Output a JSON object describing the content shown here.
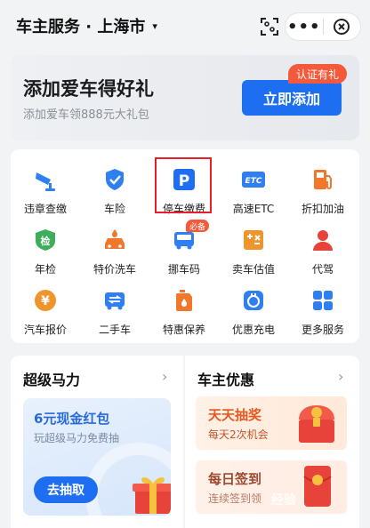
{
  "header": {
    "title": "车主服务 · 上海市",
    "caret": "▾",
    "more_label": "•••",
    "scan_icon": "scan-icon",
    "close_icon": "close-icon"
  },
  "banner": {
    "title": "添加爱车得好礼",
    "subtitle": "添加爱车领888元大礼包",
    "button_label": "立即添加",
    "badge": "认证有礼"
  },
  "services": {
    "items": [
      {
        "label": "违章查缴",
        "icon": "camera-icon"
      },
      {
        "label": "车险",
        "icon": "shield-check-icon"
      },
      {
        "label": "停车缴费",
        "icon": "parking-icon"
      },
      {
        "label": "高速ETC",
        "icon": "etc-icon"
      },
      {
        "label": "折扣加油",
        "icon": "fuel-pump-icon"
      },
      {
        "label": "年检",
        "icon": "inspection-icon"
      },
      {
        "label": "特价洗车",
        "icon": "car-wash-icon"
      },
      {
        "label": "挪车码",
        "icon": "move-car-icon"
      },
      {
        "label": "卖车估值",
        "icon": "valuation-icon"
      },
      {
        "label": "代驾",
        "icon": "driver-icon"
      },
      {
        "label": "汽车报价",
        "icon": "yuan-price-icon"
      },
      {
        "label": "二手车",
        "icon": "used-car-icon"
      },
      {
        "label": "特惠保养",
        "icon": "oil-can-icon"
      },
      {
        "label": "优惠充电",
        "icon": "charging-icon"
      },
      {
        "label": "更多服务",
        "icon": "grid-more-icon"
      }
    ],
    "must_badge": "必备",
    "inspection_glyph": "检",
    "etc_glyph": "ETC",
    "parking_glyph": "P",
    "yuan_glyph": "¥"
  },
  "super_power": {
    "title": "超级马力",
    "arrow": "›",
    "card_title": "6元现金红包",
    "card_sub": "玩超级马力免费抽",
    "button_label": "去抽取"
  },
  "owner_deals": {
    "title": "车主优惠",
    "arrow": "›",
    "promos": [
      {
        "title": "天天抽奖",
        "subtitle": "每天2次机会"
      },
      {
        "title": "每日签到",
        "subtitle": "连续签到领"
      }
    ]
  },
  "watermark": "经验",
  "colors": {
    "accent": "#1d6ef0",
    "badge": "#f4593b",
    "highlight": "#e5202b",
    "orange": "#f0772c",
    "red": "#e8433a"
  }
}
